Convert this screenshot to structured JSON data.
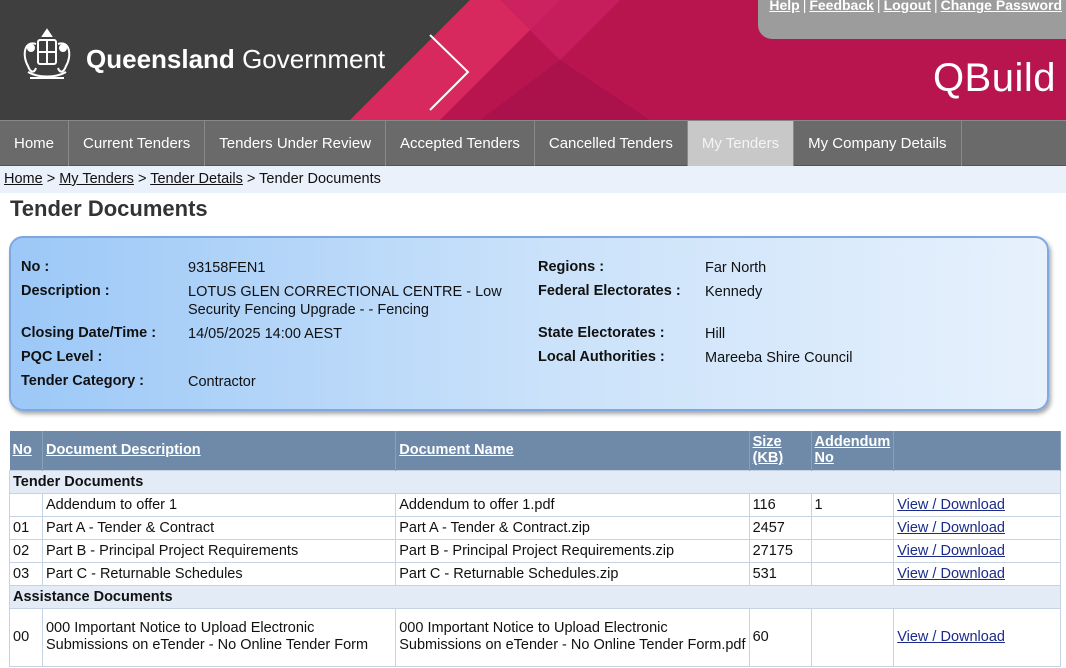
{
  "header": {
    "gov_bold": "Queensland",
    "gov_rest": "Government",
    "app_name": "QBuild",
    "links": [
      "Help",
      "Feedback",
      "Logout",
      "Change Password"
    ]
  },
  "nav": {
    "items": [
      "Home",
      "Current Tenders",
      "Tenders Under Review",
      "Accepted Tenders",
      "Cancelled Tenders",
      "My Tenders",
      "My Company Details"
    ],
    "active": "My Tenders"
  },
  "breadcrumb": {
    "links": [
      "Home",
      "My Tenders",
      "Tender Details"
    ],
    "separator": ">",
    "current": "Tender Documents"
  },
  "page_title": "Tender Documents",
  "tender": {
    "no_label": "No :",
    "no": "93158FEN1",
    "description_label": "Description :",
    "description": "LOTUS GLEN CORRECTIONAL CENTRE - Low Security Fencing Upgrade - - Fencing",
    "closing_label": "Closing Date/Time :",
    "closing": "14/05/2025 14:00 AEST",
    "pqc_label": "PQC Level :",
    "pqc": "",
    "category_label": "Tender Category :",
    "category": "Contractor",
    "regions_label": "Regions :",
    "regions": "Far North",
    "federal_label": "Federal Electorates :",
    "federal": "Kennedy",
    "state_label": "State Electorates :",
    "state": "Hill",
    "local_label": "Local Authorities :",
    "local": "Mareeba Shire Council"
  },
  "table": {
    "headers": {
      "no": "No",
      "description": "Document Description",
      "name": "Document Name",
      "size": "Size (KB)",
      "addendum": "Addendum No"
    },
    "download_label": "View / Download",
    "sections": [
      {
        "title": "Tender Documents",
        "rows": [
          {
            "no": "",
            "description": "Addendum to offer 1",
            "name": "Addendum to offer 1.pdf",
            "size": "116",
            "addendum": "1"
          },
          {
            "no": "01",
            "description": "Part A - Tender & Contract",
            "name": "Part A - Tender & Contract.zip",
            "size": "2457",
            "addendum": ""
          },
          {
            "no": "02",
            "description": "Part B - Principal Project Requirements",
            "name": "Part B - Principal Project Requirements.zip",
            "size": "27175",
            "addendum": ""
          },
          {
            "no": "03",
            "description": "Part C - Returnable Schedules",
            "name": "Part C - Returnable Schedules.zip",
            "size": "531",
            "addendum": ""
          }
        ]
      },
      {
        "title": "Assistance Documents",
        "rows": [
          {
            "no": "00",
            "description": "000 Important Notice to Upload Electronic Submissions on eTender - No Online Tender Form",
            "name": "000 Important Notice to Upload Electronic Submissions on eTender - No Online Tender Form.pdf",
            "size": "60",
            "addendum": ""
          }
        ]
      }
    ]
  },
  "colors": {
    "header_dark": "#3f3f3f",
    "header_magenta": "#b8154f",
    "nav_bg": "#6a6a6a",
    "table_header": "#6e8aa8",
    "panel_blue": "#9cc8f7"
  }
}
